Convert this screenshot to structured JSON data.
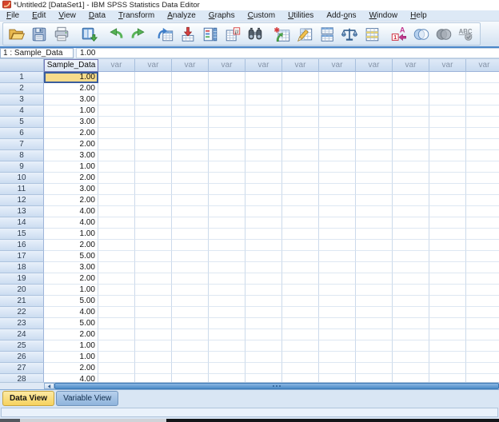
{
  "window": {
    "title": "*Untitled2 [DataSet1] - IBM SPSS Statistics Data Editor"
  },
  "menus": [
    {
      "label": "File",
      "accel": 0
    },
    {
      "label": "Edit",
      "accel": 0
    },
    {
      "label": "View",
      "accel": 0
    },
    {
      "label": "Data",
      "accel": 0
    },
    {
      "label": "Transform",
      "accel": 0
    },
    {
      "label": "Analyze",
      "accel": 0
    },
    {
      "label": "Graphs",
      "accel": 0
    },
    {
      "label": "Custom",
      "accel": 0
    },
    {
      "label": "Utilities",
      "accel": 0
    },
    {
      "label": "Add-ons",
      "accel": 4
    },
    {
      "label": "Window",
      "accel": 0
    },
    {
      "label": "Help",
      "accel": 0
    }
  ],
  "toolbar": {
    "groups": [
      [
        "open-data",
        "save",
        "print"
      ],
      [
        "recall-dialogs"
      ],
      [
        "undo",
        "redo"
      ],
      [
        "goto-case",
        "goto-variable",
        "variables",
        "descriptive-statistics",
        "find"
      ],
      [
        "insert-cases",
        "insert-variable",
        "split-file",
        "weight-cases",
        "select-cases"
      ],
      [
        "value-labels",
        "use-variable-sets",
        "show-all-variables",
        "spell-check"
      ]
    ]
  },
  "cell_reference": {
    "label": "1 : Sample_Data",
    "editor_value": "1.00"
  },
  "grid": {
    "variable_column_header": "Sample_Data",
    "var_header_label": "var",
    "var_column_count": 11,
    "selected_cell": {
      "row": 1,
      "column": "Sample_Data",
      "value": "1.00"
    },
    "rows": [
      {
        "row": 1,
        "value": "1.00"
      },
      {
        "row": 2,
        "value": "2.00"
      },
      {
        "row": 3,
        "value": "3.00"
      },
      {
        "row": 4,
        "value": "1.00"
      },
      {
        "row": 5,
        "value": "3.00"
      },
      {
        "row": 6,
        "value": "2.00"
      },
      {
        "row": 7,
        "value": "2.00"
      },
      {
        "row": 8,
        "value": "3.00"
      },
      {
        "row": 9,
        "value": "1.00"
      },
      {
        "row": 10,
        "value": "2.00"
      },
      {
        "row": 11,
        "value": "3.00"
      },
      {
        "row": 12,
        "value": "2.00"
      },
      {
        "row": 13,
        "value": "4.00"
      },
      {
        "row": 14,
        "value": "4.00"
      },
      {
        "row": 15,
        "value": "1.00"
      },
      {
        "row": 16,
        "value": "2.00"
      },
      {
        "row": 17,
        "value": "5.00"
      },
      {
        "row": 18,
        "value": "3.00"
      },
      {
        "row": 19,
        "value": "2.00"
      },
      {
        "row": 20,
        "value": "1.00"
      },
      {
        "row": 21,
        "value": "5.00"
      },
      {
        "row": 22,
        "value": "4.00"
      },
      {
        "row": 23,
        "value": "5.00"
      },
      {
        "row": 24,
        "value": "2.00"
      },
      {
        "row": 25,
        "value": "1.00"
      },
      {
        "row": 26,
        "value": "1.00"
      },
      {
        "row": 27,
        "value": "2.00"
      },
      {
        "row": 28,
        "value": "4.00"
      }
    ]
  },
  "tabs": {
    "data_view": "Data View",
    "variable_view": "Variable View"
  },
  "colors": {
    "selected_cell_bg": "#F7DB8B",
    "selected_cell_border": "#3A5D9E",
    "active_tab_bg": "#F6D25E",
    "inactive_tab_bg": "#8FB4DC",
    "scrollbar_thumb": "#4D8CC8",
    "toolbar_accent_line": "#4B87C9",
    "header_bg": "#C9DBF0"
  }
}
